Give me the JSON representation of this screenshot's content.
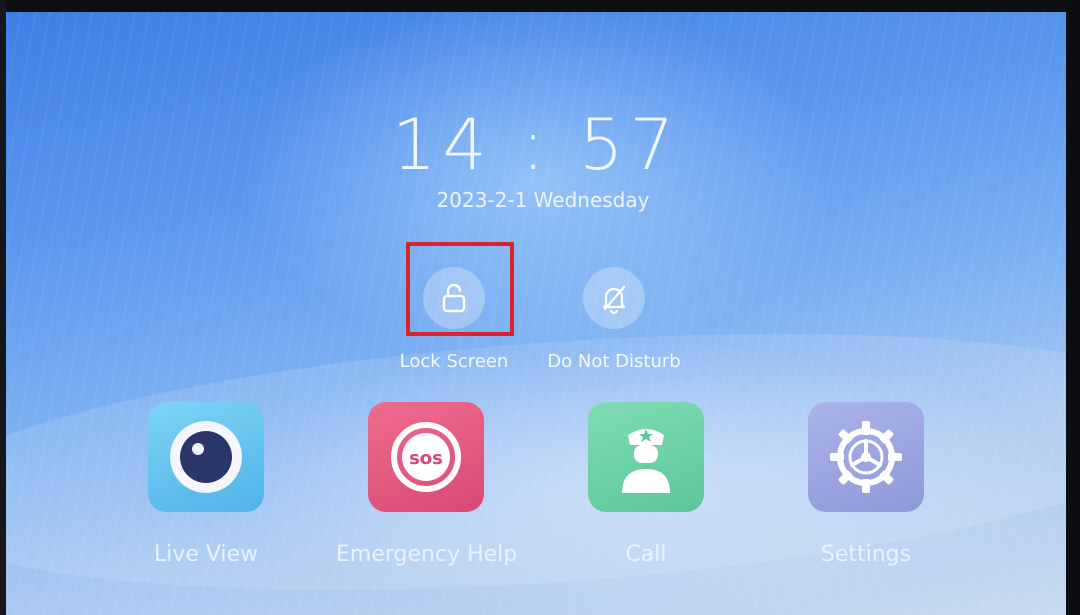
{
  "clock": {
    "time": "14 : 57",
    "date": "2023-2-1 Wednesday"
  },
  "quick_actions": [
    {
      "label": "Lock Screen",
      "icon": "lock-open-icon"
    },
    {
      "label": "Do Not Disturb",
      "icon": "bell-off-icon"
    }
  ],
  "apps": [
    {
      "label": "Live View",
      "icon": "camera-eye-icon",
      "color": "#5cc2f0"
    },
    {
      "label": "Emergency Help",
      "icon": "sos-icon",
      "color": "#e0527a"
    },
    {
      "label": "Call",
      "icon": "guard-icon",
      "color": "#6fd3a6"
    },
    {
      "label": "Settings",
      "icon": "gear-icon",
      "color": "#9aa2de"
    }
  ],
  "highlight": {
    "color": "#d6262c",
    "target": "Lock Screen"
  }
}
